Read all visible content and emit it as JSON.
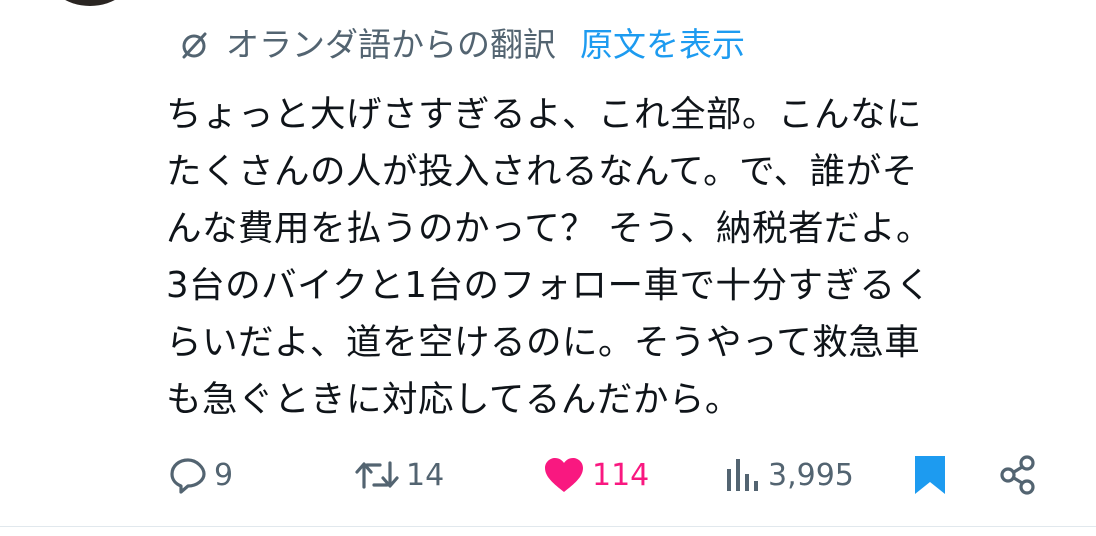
{
  "translation": {
    "note": "オランダ語からの翻訳",
    "show_original": "原文を表示",
    "icon": "globe-off-icon"
  },
  "tweet": {
    "lines": [
      "ちょっと大げさすぎるよ、これ全部。こんなに",
      "たくさんの人が投入されるなんて。で、誰がそ",
      "んな費用を払うのかって？ そう、納税者だよ。",
      "3台のバイクと1台のフォロー車で十分すぎるく",
      "らいだよ、道を空けるのに。そうやって救急車",
      "も急ぐときに対応してるんだから。"
    ]
  },
  "actions": {
    "replies": "9",
    "retweets": "14",
    "likes": "114",
    "views": "3,995"
  },
  "colors": {
    "muted": "#536471",
    "link": "#1d9bf0",
    "like": "#f91880",
    "bookmark": "#1d9bf0"
  }
}
